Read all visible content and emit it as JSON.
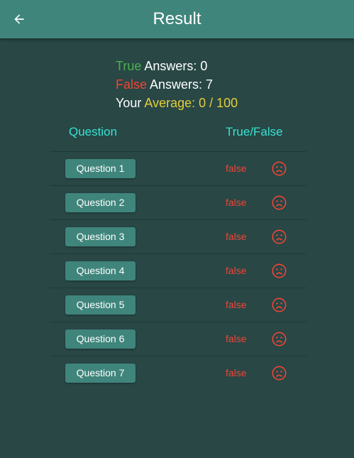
{
  "header": {
    "title": "Result",
    "back_icon": "arrow-back-icon"
  },
  "summary": {
    "true_word": "True",
    "true_rest": " Answers: 0",
    "false_word": "False",
    "false_rest": " Answers: 7",
    "your_label": "Your ",
    "average_text": "Average: 0 / 100"
  },
  "table": {
    "col_question": "Question",
    "col_truefalse": "True/False",
    "rows": [
      {
        "label": "Question 1",
        "result": "false",
        "icon": "sad-face-icon"
      },
      {
        "label": "Question 2",
        "result": "false",
        "icon": "sad-face-icon"
      },
      {
        "label": "Question 3",
        "result": "false",
        "icon": "sad-face-icon"
      },
      {
        "label": "Question 4",
        "result": "false",
        "icon": "sad-face-icon"
      },
      {
        "label": "Question 5",
        "result": "false",
        "icon": "sad-face-icon"
      },
      {
        "label": "Question 6",
        "result": "false",
        "icon": "sad-face-icon"
      },
      {
        "label": "Question 7",
        "result": "false",
        "icon": "sad-face-icon"
      }
    ]
  },
  "colors": {
    "appbar": "#3f857c",
    "background": "#284745",
    "true": "#4caf50",
    "false": "#f44336",
    "average": "#e3cf3b",
    "column_header": "#36e3d3"
  }
}
